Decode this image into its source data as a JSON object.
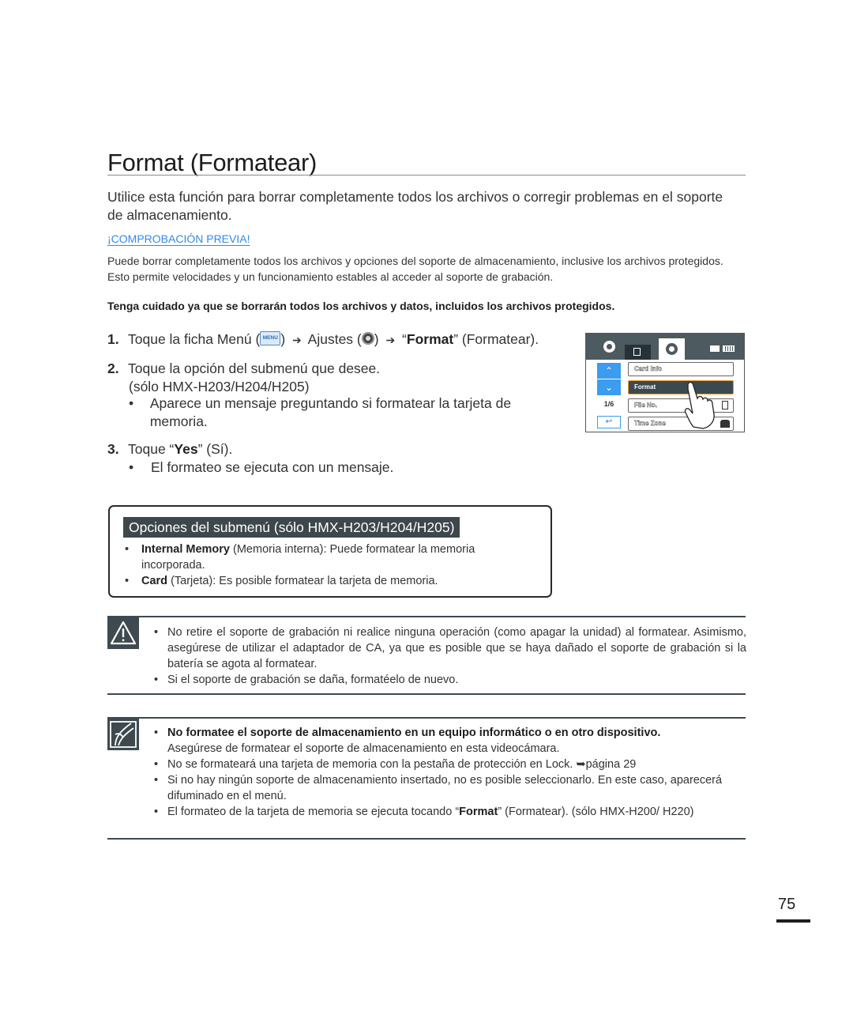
{
  "title": "Format (Formatear)",
  "intro": "Utilice esta función para borrar completamente todos los archivos o corregir problemas en el soporte de almacenamiento.",
  "precheck": {
    "heading": "¡COMPROBACIÓN PREVIA!",
    "body": "Puede borrar completamente todos los archivos y opciones del soporte de almacenamiento, inclusive los archivos protegidos. Esto permite velocidades y un funcionamiento estables al acceder al soporte de grabación.",
    "warning": "Tenga cuidado ya que se borrarán todos los archivos y datos, incluidos los archivos protegidos."
  },
  "steps": [
    {
      "num": "1.",
      "prefix": "Toque la ficha Menú (",
      "menu_icon_label": "MENU",
      "mid1": ") ",
      "arrow": "➔",
      "ajustes": " Ajustes (",
      "mid2": ") ",
      "quote_open": " “",
      "bold": "Format",
      "suffix": "” (Formatear)."
    },
    {
      "num": "2.",
      "text": "Toque la opción del submenú que desee.",
      "line2": "(sólo HMX-H203/H204/H205)",
      "bullet": "Aparece un mensaje preguntando si formatear la tarjeta de memoria."
    },
    {
      "num": "3.",
      "prefix": "Toque “",
      "bold": "Yes",
      "suffix": "” (Sí).",
      "bullet": "El formateo se ejecuta con un mensaje."
    }
  ],
  "camera_screen": {
    "tabs": [
      "gear-icon",
      "menu-icon",
      "settings-icon"
    ],
    "page_indicator": "1/6",
    "items": [
      "Card Info",
      "Format",
      "File No.",
      "Time Zone"
    ],
    "selected_item": "Format",
    "up_label": "⌃",
    "down_label": "⌄",
    "back_label": "↩"
  },
  "submenu": {
    "title": "Opciones del submenú (sólo HMX-H203/H204/H205)",
    "items": [
      {
        "bold": "Internal Memory",
        "text": " (Memoria interna): Puede formatear la memoria incorporada."
      },
      {
        "bold": "Card",
        "text": " (Tarjeta): Es posible formatear la tarjeta de memoria."
      }
    ]
  },
  "warning_note": {
    "items": [
      "No retire el soporte de grabación ni realice ninguna operación (como apagar la unidad) al formatear. Asimismo, asegúrese de utilizar el adaptador de CA, ya que es posible que se haya dañado el soporte de grabación si la batería se agota al formatear.",
      "Si el soporte de grabación se daña, formatéelo de nuevo."
    ]
  },
  "info_note": {
    "item1_bold": "No formatee el soporte de almacenamiento en un equipo informático o en otro dispositivo.",
    "item1_text": "Asegúrese de formatear el soporte de almacenamiento en esta videocámara.",
    "item2_text": "No se formateará una tarjeta de memoria con la pestaña de protección en Lock. ",
    "item2_link": "➥página 29",
    "item3_text": "Si no hay ningún soporte de almacenamiento insertado, no es posible seleccionarlo. En este caso, aparecerá difuminado en el menú.",
    "item4_prefix": "El formateo de la tarjeta de memoria se ejecuta tocando “",
    "item4_bold": "Format",
    "item4_suffix": "” (Formatear). (sólo HMX-H200/ H220)"
  },
  "page_number": "75"
}
